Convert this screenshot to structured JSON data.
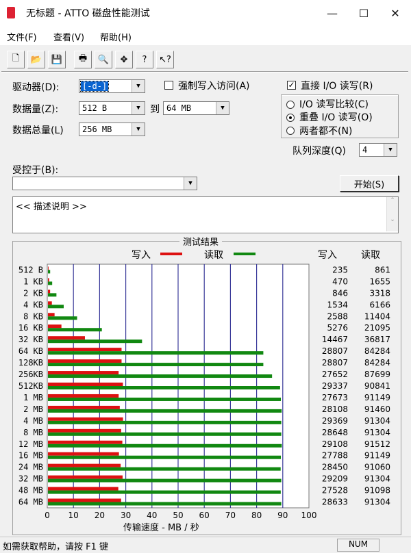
{
  "window": {
    "title": "无标题 - ATTO 磁盘性能测试",
    "minimize": "—",
    "maximize": "☐",
    "close": "✕"
  },
  "menu": [
    "文件(F)",
    "查看(V)",
    "帮助(H)"
  ],
  "toolbar": [
    {
      "name": "new-icon",
      "glyph": "🗋"
    },
    {
      "name": "open-icon",
      "glyph": "📂"
    },
    {
      "name": "save-icon",
      "glyph": "💾"
    },
    {
      "name": "print-icon",
      "glyph": "🖶"
    },
    {
      "name": "print-preview-icon",
      "glyph": "🔍"
    },
    {
      "name": "move-icon",
      "glyph": "✥"
    },
    {
      "name": "help-icon",
      "glyph": "?"
    },
    {
      "name": "context-help-icon",
      "glyph": "↖?"
    }
  ],
  "form": {
    "drive_label": "驱动器(D):",
    "drive_value": "[-d-]",
    "force_write_label": "强制写入访问(A)",
    "direct_io_label": "直接 I/O 读写(R)",
    "transfer_label": "数据量(Z):",
    "transfer_from": "512 B",
    "to_label": "到",
    "transfer_to": "64 MB",
    "total_label": "数据总量(L)",
    "total_value": "256 MB",
    "radio_compare": "I/O 读写比较(C)",
    "radio_overlap": "重叠 I/O 读写(O)",
    "radio_neither": "两者都不(N)",
    "queue_label": "队列深度(Q)",
    "queue_value": "4",
    "controlled_label": "受控于(B):",
    "controlled_value": "",
    "start_button": "开始(S)",
    "description": "<< 描述说明 >>"
  },
  "chart_data": {
    "type": "bar",
    "title": "测试结果",
    "legend": [
      "写入",
      "读取"
    ],
    "colors": {
      "write": "#dd1111",
      "read": "#118811"
    },
    "xlabel": "传输速度  -  MB / 秒",
    "xlim": [
      0,
      100
    ],
    "xticks": [
      "0",
      "10",
      "20",
      "30",
      "40",
      "50",
      "60",
      "70",
      "80",
      "90",
      "100"
    ],
    "col_write": "写入",
    "col_read": "读取",
    "categories": [
      "512 B",
      "1 KB",
      "2 KB",
      "4 KB",
      "8 KB",
      "16 KB",
      "32 KB",
      "64 KB",
      "128KB",
      "256KB",
      "512KB",
      "1 MB",
      "2 MB",
      "4 MB",
      "8 MB",
      "12 MB",
      "16 MB",
      "24 MB",
      "32 MB",
      "48 MB",
      "64 MB"
    ],
    "write_kb": [
      235,
      470,
      846,
      1534,
      2588,
      5276,
      14467,
      28807,
      28807,
      27652,
      29337,
      27673,
      28108,
      29369,
      28648,
      29108,
      27788,
      28450,
      29209,
      27528,
      28633
    ],
    "read_kb": [
      861,
      1655,
      3318,
      6166,
      11404,
      21095,
      36817,
      84284,
      84284,
      87699,
      90841,
      91149,
      91460,
      91304,
      91304,
      91512,
      91149,
      91060,
      91304,
      91098,
      91304
    ]
  },
  "status": {
    "text": "如需获取帮助，请按 F1 键",
    "indicator": "NUM"
  }
}
